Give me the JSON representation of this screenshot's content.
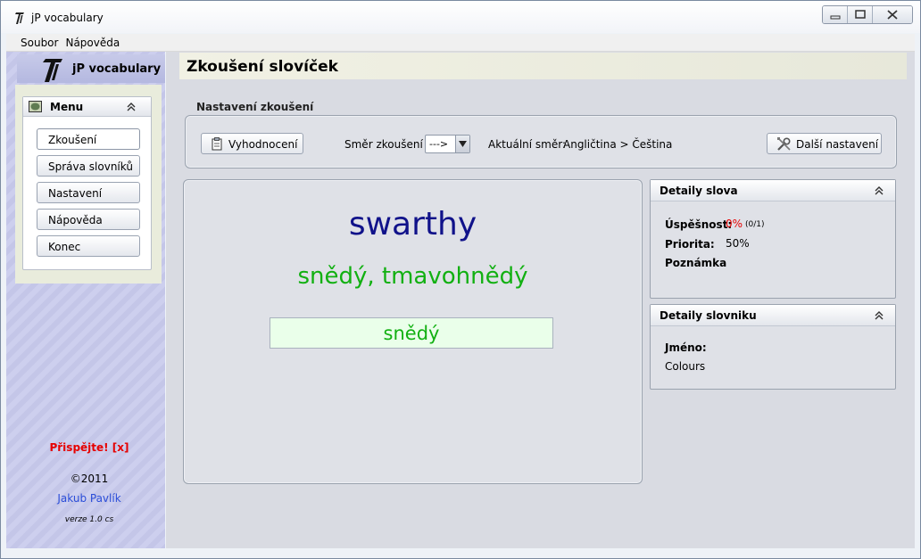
{
  "window": {
    "title": "jP vocabulary"
  },
  "menubar": {
    "items": [
      "Soubor",
      "Nápověda"
    ]
  },
  "sidebar": {
    "brand": "jP vocabulary",
    "menu_title": "Menu",
    "items": [
      {
        "label": "Zkoušení"
      },
      {
        "label": "Správa slovníků"
      },
      {
        "label": "Nastavení"
      },
      {
        "label": "Nápověda"
      },
      {
        "label": "Konec"
      }
    ],
    "active_item": "Zkoušení",
    "donate": "Přispějte! [x]",
    "copyright": "©2011",
    "author": "Jakub Pavlík",
    "version": "verze 1.0 cs"
  },
  "main": {
    "page_title": "Zkoušení slovíček",
    "settings": {
      "caption": "Nastavení zkoušení",
      "evaluate_label": "Vyhodnocení",
      "direction_label": "Směr zkoušení",
      "direction_value": "--->",
      "current_direction_label": "Aktuální směr:",
      "current_direction_value": "Angličtina > Čeština",
      "more_settings_label": "Další nastavení"
    },
    "quiz": {
      "word": "swarthy",
      "translation": "snědý, tmavohnědý",
      "answer_value": "snědý"
    },
    "word_details": {
      "title": "Detaily slova",
      "success_label": "Úspěšnost:",
      "success_value": "0%",
      "success_count": "(0/1)",
      "priority_label": "Priorita:",
      "priority_value": "50%",
      "note_label": "Poznámka"
    },
    "dictionary_details": {
      "title": "Detaily slovniku",
      "name_label": "Jméno:",
      "name_value": "Colours"
    }
  },
  "colors": {
    "word": "#10128a",
    "translation": "#12b012",
    "donate": "#e60000",
    "author_link": "#2a4dd8"
  },
  "icons": {
    "app": "jp-logo-icon",
    "menu": "menu-panel-icon",
    "evaluate": "clipboard-icon",
    "more_settings": "tools-icon",
    "collapse": "double-chevron-up-icon"
  }
}
